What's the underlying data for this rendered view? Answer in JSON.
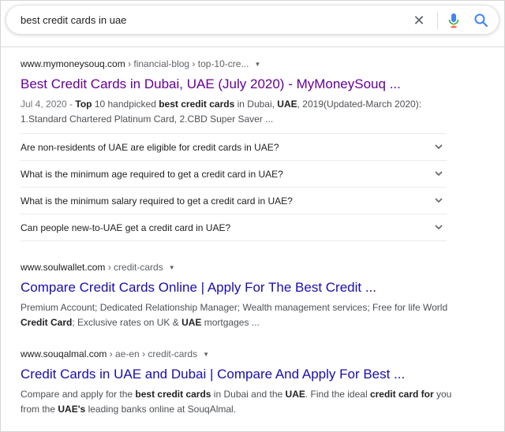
{
  "search": {
    "query": "best credit cards in uae",
    "clear_icon": "close-icon",
    "mic_icon": "microphone-icon",
    "search_icon": "search-icon"
  },
  "results": [
    {
      "domain": "www.mymoneysouq.com",
      "path": " › financial-blog › top-10-cre...",
      "title": "Best Credit Cards in Dubai, UAE (July 2020) - MyMoneySouq ...",
      "visited": true,
      "date": "Jul 4, 2020 - ",
      "snippet_parts": [
        "Top",
        " 10 handpicked ",
        "best credit cards",
        " in Dubai, ",
        "UAE",
        ", 2019(Updated-March 2020): 1.Standard Chartered Platinum Card, 2.CBD Super Saver ..."
      ]
    },
    {
      "domain": "www.soulwallet.com",
      "path": " › credit-cards",
      "title": "Compare Credit Cards Online | Apply For The Best Credit ...",
      "visited": false,
      "snippet_parts": [
        "Premium Account; Dedicated Relationship Manager; Wealth management services; Free for life World ",
        "Credit Card",
        "; Exclusive rates on UK & ",
        "UAE",
        " mortgages ..."
      ]
    },
    {
      "domain": "www.souqalmal.com",
      "path": " › ae-en › credit-cards",
      "title": "Credit Cards in UAE and Dubai | Compare And Apply For Best ...",
      "visited": false,
      "snippet_parts": [
        "Compare and apply for the ",
        "best credit cards",
        " in Dubai and the ",
        "UAE",
        ". Find the ideal ",
        "credit card",
        " ",
        "for",
        " you from the ",
        "UAE's",
        " leading banks online at SouqAlmal."
      ]
    }
  ],
  "faq": [
    "Are non-residents of UAE are eligible for credit cards in UAE?",
    "What is the minimum age required to get a credit card in UAE?",
    "What is the minimum salary required to get a credit card in UAE?",
    "Can people new-to-UAE get a credit card in UAE?"
  ],
  "colors": {
    "link": "#1a0dab",
    "visited": "#660099",
    "mic_blue": "#4285f4",
    "mic_red": "#ea4335",
    "search_blue": "#4285f4"
  }
}
